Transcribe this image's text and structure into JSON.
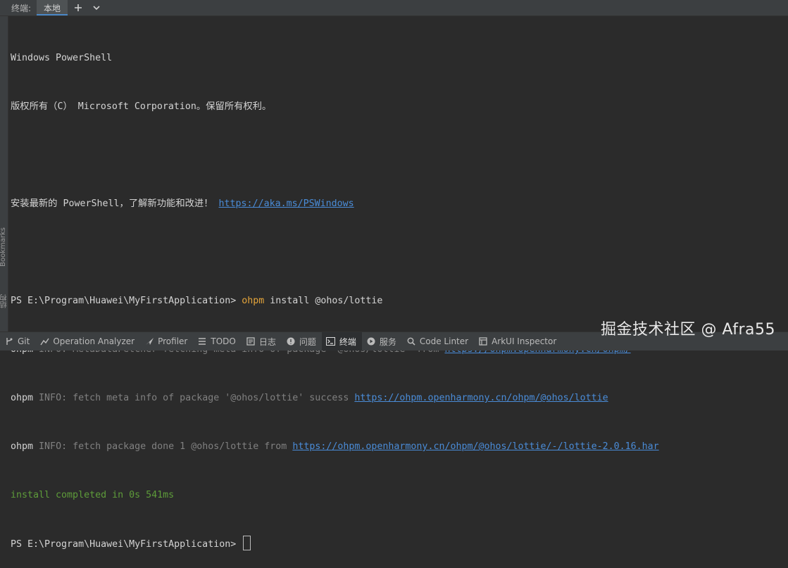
{
  "tabbar": {
    "title": "终端:",
    "active_tab": "本地"
  },
  "sidebar": {
    "bookmarks_label": "Bookmarks",
    "structure_label": "结构"
  },
  "terminal": {
    "header1": "Windows PowerShell",
    "header2": "版权所有（C） Microsoft Corporation。保留所有权利。",
    "install_msg_text": "安装最新的 PowerShell，了解新功能和改进！",
    "install_msg_link": "https://aka.ms/PSWindows",
    "prompt": "PS E:\\Program\\Huawei\\MyFirstApplication>",
    "command_exe": "ohpm",
    "command_args": "install @ohos/lottie",
    "log": [
      {
        "prefix": "ohpm",
        "text": "INFO: MetaDataFetcher fetching meta info of package '@ohos/lottie' from",
        "link": "https://ohpm.openharmony.cn/ohpm/"
      },
      {
        "prefix": "ohpm",
        "text": "INFO: fetch meta info of package '@ohos/lottie' success",
        "link": "https://ohpm.openharmony.cn/ohpm/@ohos/lottie"
      },
      {
        "prefix": "ohpm",
        "text": "INFO: fetch package done 1 @ohos/lottie from",
        "link": "https://ohpm.openharmony.cn/ohpm/@ohos/lottie/-/lottie-2.0.16.har"
      }
    ],
    "success": "install completed in 0s 541ms"
  },
  "bottombar": {
    "items": [
      {
        "label": "Git",
        "icon": "git-branch-icon"
      },
      {
        "label": "Operation Analyzer",
        "icon": "chart-icon"
      },
      {
        "label": "Profiler",
        "icon": "profiler-icon"
      },
      {
        "label": "TODO",
        "icon": "list-icon"
      },
      {
        "label": "日志",
        "icon": "log-icon"
      },
      {
        "label": "问题",
        "icon": "info-icon"
      },
      {
        "label": "终端",
        "icon": "terminal-icon"
      },
      {
        "label": "服务",
        "icon": "play-icon"
      },
      {
        "label": "Code Linter",
        "icon": "search-icon"
      },
      {
        "label": "ArkUI Inspector",
        "icon": "inspector-icon"
      }
    ]
  },
  "watermark": "掘金技术社区 @ Afra55"
}
